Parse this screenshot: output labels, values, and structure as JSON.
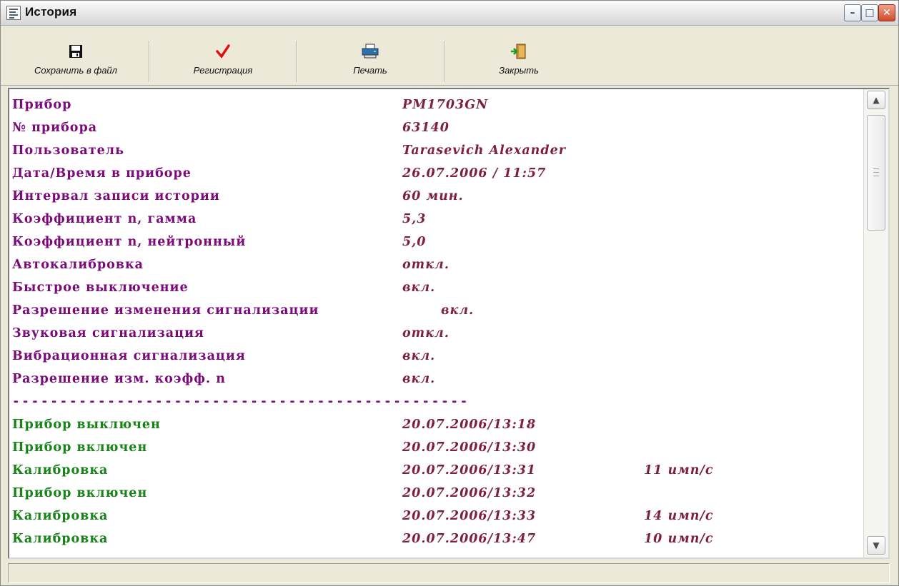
{
  "window": {
    "title": "История",
    "icon": "app-window-icon",
    "controls": [
      {
        "name": "minimize-button",
        "glyph": "–"
      },
      {
        "name": "maximize-button",
        "glyph": "□"
      },
      {
        "name": "close-button",
        "glyph": "✕"
      }
    ]
  },
  "toolbar": {
    "save_label": "Сохранить в файл",
    "register_label": "Регистрация",
    "print_label": "Печать",
    "close_label": "Закрыть",
    "icons": {
      "save": "floppy-disk-icon",
      "register": "checkmark-icon",
      "print": "printer-icon",
      "close": "door-exit-icon"
    }
  },
  "info_rows": [
    {
      "label": "Прибор",
      "value": "PM1703GN"
    },
    {
      "label": "№ прибора",
      "value": "63140"
    },
    {
      "label": "Пользователь",
      "value": "Tarasevich Alexander"
    },
    {
      "label": "Дата/Время в приборе",
      "value": "26.07.2006 / 11:57"
    },
    {
      "label": "Интервал записи истории",
      "value": "60 мин."
    },
    {
      "label": "Коэффициент n, гамма",
      "value": "5,3"
    },
    {
      "label": "Коэффициент n, нейтронный",
      "value": "5,0"
    },
    {
      "label": "Автокалибровка",
      "value": "откл."
    },
    {
      "label": "Быстрое выключение",
      "value": "вкл."
    },
    {
      "label": "Разрешение изменения сигнализации",
      "value": "вкл."
    },
    {
      "label": "Звуковая сигнализация",
      "value": "откл."
    },
    {
      "label": "Вибрационная сигнализация",
      "value": "вкл."
    },
    {
      "label": "Разрешение изм. коэфф. n",
      "value": "вкл."
    }
  ],
  "separator": "------------------------------------------------",
  "events": [
    {
      "label": "Прибор выключен",
      "value": "20.07.2006/13:18",
      "extra": ""
    },
    {
      "label": "Прибор включен",
      "value": "20.07.2006/13:30",
      "extra": ""
    },
    {
      "label": "Калибровка",
      "value": "20.07.2006/13:31",
      "extra": "11 имп/с"
    },
    {
      "label": "Прибор включен",
      "value": "20.07.2006/13:32",
      "extra": ""
    },
    {
      "label": "Калибровка",
      "value": "20.07.2006/13:33",
      "extra": "14 имп/с"
    },
    {
      "label": "Калибровка",
      "value": "20.07.2006/13:47",
      "extra": "10 имп/с"
    }
  ],
  "colors": {
    "info_label": "#7a0a7a",
    "info_value": "#7e1f3d",
    "event_label": "#178217",
    "event_value": "#7e1f3d"
  },
  "status": {
    "text": ""
  }
}
